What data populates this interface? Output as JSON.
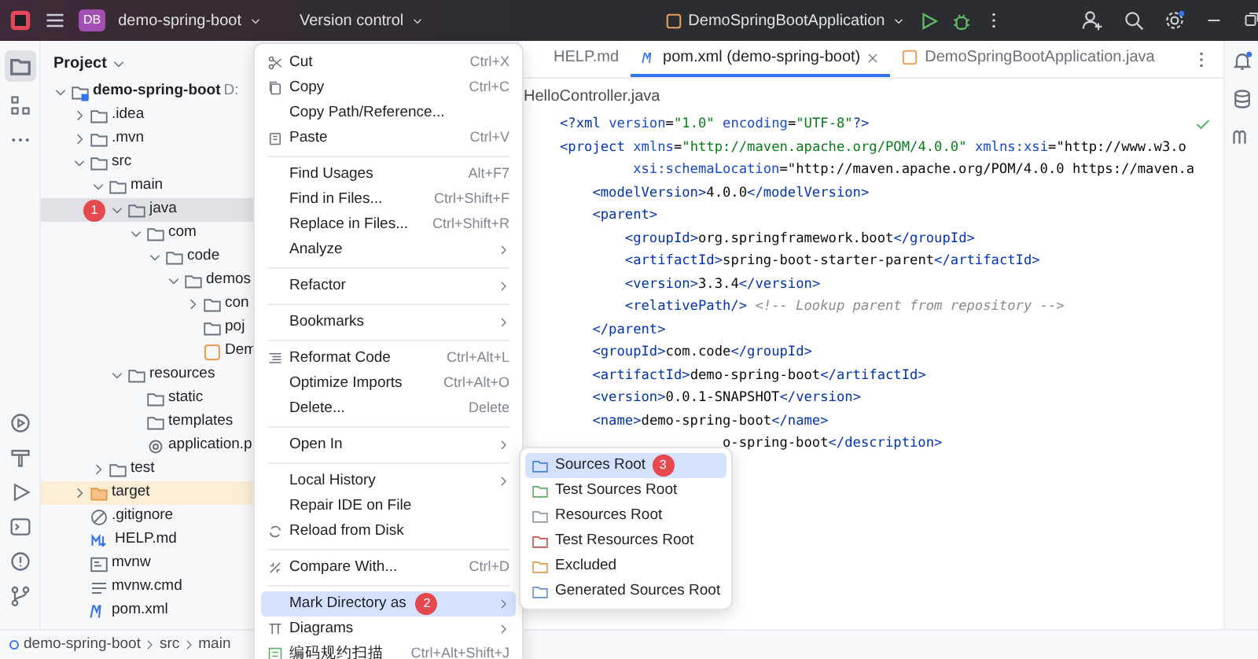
{
  "title_bar": {
    "project_badge": "DB",
    "project": "demo-spring-boot",
    "vcs": "Version control",
    "run_config": "DemoSpringBootApplication"
  },
  "project_panel": {
    "title": "Project",
    "tree": [
      {
        "label": "demo-spring-boot",
        "suffix": "D:",
        "kind": "module",
        "expanded": true,
        "selected": false,
        "children": [
          {
            "label": ".idea",
            "kind": "folder",
            "expanded": false,
            "selected": false
          },
          {
            "label": ".mvn",
            "kind": "folder",
            "expanded": false,
            "selected": false
          },
          {
            "label": "src",
            "kind": "folder",
            "expanded": true,
            "selected": false,
            "children": [
              {
                "label": "main",
                "kind": "folder",
                "expanded": true,
                "selected": false,
                "children": [
                  {
                    "label": "java",
                    "kind": "folder",
                    "expanded": true,
                    "selected": true,
                    "badge": "1",
                    "children": [
                      {
                        "label": "com",
                        "kind": "folder",
                        "expanded": true,
                        "selected": false,
                        "children": [
                          {
                            "label": "code",
                            "kind": "folder",
                            "expanded": true,
                            "selected": false,
                            "children": [
                              {
                                "label": "demos",
                                "kind": "folder",
                                "expanded": true,
                                "selected": false,
                                "children": [
                                  {
                                    "label": "con",
                                    "kind": "folder",
                                    "expanded": false,
                                    "selected": false
                                  },
                                  {
                                    "label": "poj",
                                    "kind": "folder",
                                    "selected": false
                                  },
                                  {
                                    "label": "Dem",
                                    "kind": "java",
                                    "selected": false
                                  }
                                ]
                              }
                            ]
                          }
                        ]
                      }
                    ]
                  },
                  {
                    "label": "resources",
                    "kind": "folder",
                    "expanded": true,
                    "selected": false,
                    "children": [
                      {
                        "label": "static",
                        "kind": "folder",
                        "selected": false
                      },
                      {
                        "label": "templates",
                        "kind": "folder",
                        "selected": false
                      },
                      {
                        "label": "application.p",
                        "kind": "config",
                        "selected": false
                      }
                    ]
                  }
                ]
              },
              {
                "label": "test",
                "kind": "folder",
                "expanded": false,
                "selected": false
              }
            ]
          },
          {
            "label": "target",
            "kind": "excluded",
            "expanded": false,
            "selected": false
          },
          {
            "label": ".gitignore",
            "kind": "ignore",
            "selected": false
          },
          {
            "label": "HELP.md",
            "kind": "md",
            "selected": false
          },
          {
            "label": "mvnw",
            "kind": "script",
            "selected": false
          },
          {
            "label": "mvnw.cmd",
            "kind": "cmd",
            "selected": false
          },
          {
            "label": "pom.xml",
            "kind": "xml",
            "selected": false
          }
        ]
      }
    ]
  },
  "editor": {
    "tabs": [
      {
        "label": "HELP.md",
        "kind": "md",
        "selected": false
      },
      {
        "label": "pom.xml (demo-spring-boot)",
        "kind": "xml",
        "selected": true
      },
      {
        "label": "DemoSpringBootApplication.java",
        "kind": "java",
        "selected": false
      }
    ],
    "breadcrumb": "HelloController.java",
    "lines": [
      "<?xml version=\"1.0\" encoding=\"UTF-8\"?>",
      "<project xmlns=\"http://maven.apache.org/POM/4.0.0\" xmlns:xsi=\"http://www.w3.o",
      "         xsi:schemaLocation=\"http://maven.apache.org/POM/4.0.0 https://maven.a",
      "    <modelVersion>4.0.0</modelVersion>",
      "    <parent>",
      "        <groupId>org.springframework.boot</groupId>",
      "        <artifactId>spring-boot-starter-parent</artifactId>",
      "        <version>3.3.4</version>",
      "        <relativePath/> <!-- Lookup parent from repository -->",
      "    </parent>",
      "    <groupId>com.code</groupId>",
      "    <artifactId>demo-spring-boot</artifactId>",
      "    <version>0.0.1-SNAPSHOT</version>",
      "    <name>demo-spring-boot</name>",
      "                    o-spring-boot</description>"
    ]
  },
  "context_menu": {
    "groups": [
      [
        {
          "label": "Cut",
          "shortcut": "Ctrl+X",
          "kind": "scissors",
          "submenu": false,
          "selected": false
        },
        {
          "label": "Copy",
          "shortcut": "Ctrl+C",
          "kind": "copy",
          "submenu": false,
          "selected": false
        },
        {
          "label": "Copy Path/Reference...",
          "submenu": false,
          "selected": false
        },
        {
          "label": "Paste",
          "shortcut": "Ctrl+V",
          "kind": "paste",
          "submenu": false,
          "selected": false
        }
      ],
      [
        {
          "label": "Find Usages",
          "shortcut": "Alt+F7",
          "submenu": false,
          "selected": false
        },
        {
          "label": "Find in Files...",
          "shortcut": "Ctrl+Shift+F",
          "submenu": false,
          "selected": false
        },
        {
          "label": "Replace in Files...",
          "shortcut": "Ctrl+Shift+R",
          "submenu": false,
          "selected": false
        },
        {
          "label": "Analyze",
          "submenu": true,
          "selected": false
        }
      ],
      [
        {
          "label": "Refactor",
          "submenu": true,
          "selected": false
        }
      ],
      [
        {
          "label": "Bookmarks",
          "submenu": true,
          "selected": false
        }
      ],
      [
        {
          "label": "Reformat Code",
          "shortcut": "Ctrl+Alt+L",
          "kind": "lines",
          "submenu": false,
          "selected": false
        },
        {
          "label": "Optimize Imports",
          "shortcut": "Ctrl+Alt+O",
          "submenu": false,
          "selected": false
        },
        {
          "label": "Delete...",
          "shortcut": "Delete",
          "submenu": false,
          "selected": false
        }
      ],
      [
        {
          "label": "Open In",
          "submenu": true,
          "selected": false
        }
      ],
      [
        {
          "label": "Local History",
          "submenu": true,
          "selected": false
        },
        {
          "label": "Repair IDE on File",
          "submenu": false,
          "selected": false
        },
        {
          "label": "Reload from Disk",
          "kind": "reload",
          "submenu": false,
          "selected": false
        }
      ],
      [
        {
          "label": "Compare With...",
          "shortcut": "Ctrl+D",
          "kind": "compare",
          "submenu": false,
          "selected": false
        }
      ],
      [
        {
          "label": "Mark Directory as",
          "badge": "2",
          "submenu": true,
          "selected": true
        },
        {
          "label": "Diagrams",
          "kind": "diagram",
          "submenu": true,
          "selected": false
        },
        {
          "label": "编码规约扫描",
          "shortcut": "Ctrl+Alt+Shift+J",
          "kind": "scan",
          "submenu": false,
          "selected": false
        }
      ]
    ]
  },
  "submenu": {
    "items": [
      {
        "label": "Sources Root",
        "color": "#4a80d9",
        "badge": "3",
        "selected": true
      },
      {
        "label": "Test Sources Root",
        "color": "#5fad65",
        "selected": false
      },
      {
        "label": "Resources Root",
        "color": "#8c96a8",
        "selected": false
      },
      {
        "label": "Test Resources Root",
        "color": "#c94f4f",
        "selected": false
      },
      {
        "label": "Excluded",
        "color": "#e59a4b",
        "selected": false
      },
      {
        "label": "Generated Sources Root",
        "color": "#6b8ed6",
        "selected": false
      }
    ]
  },
  "status_bar": {
    "path": [
      "demo-spring-boot",
      "src",
      "main"
    ]
  }
}
